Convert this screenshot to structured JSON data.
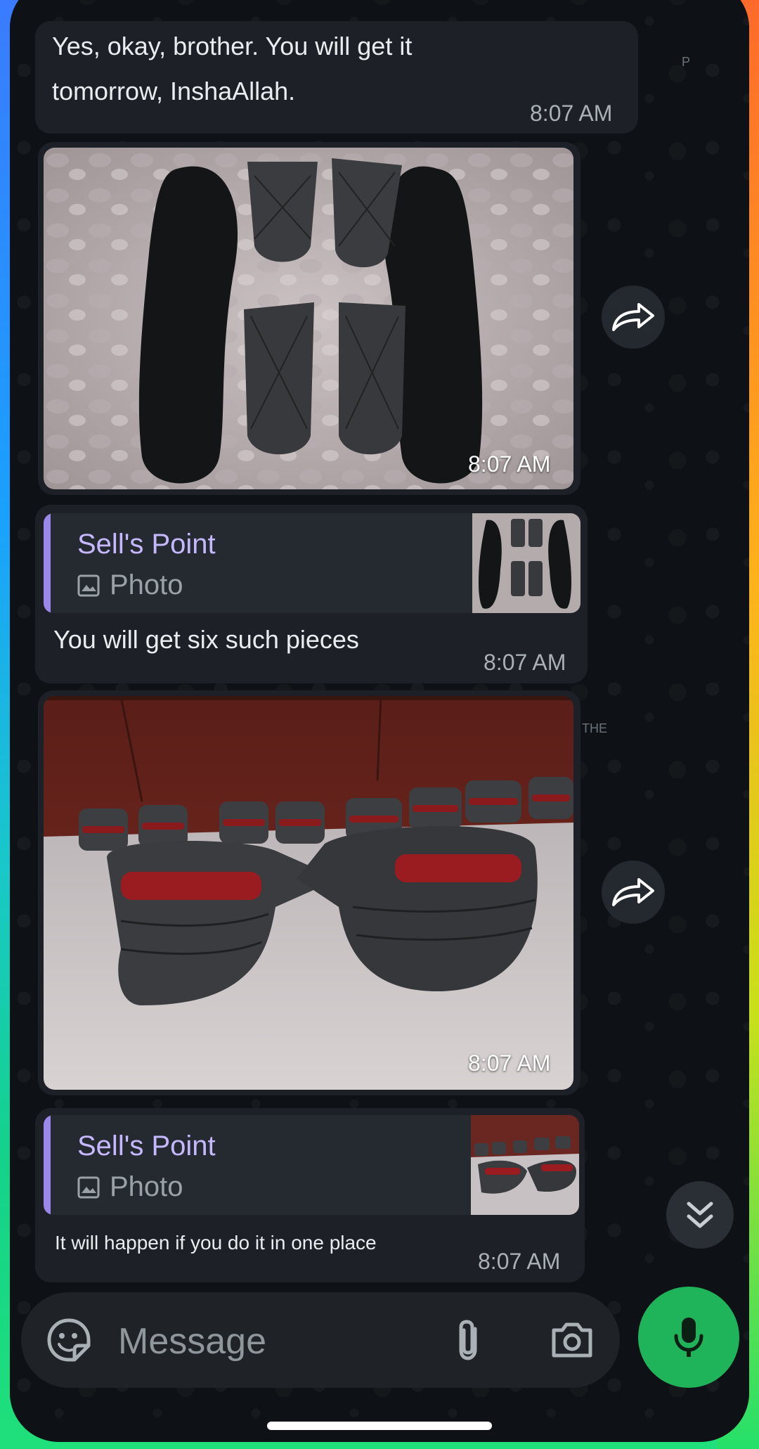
{
  "messages": {
    "text1": {
      "text": "Yes, okay, brother. You will get it tomorrow, InshaAllah.",
      "time": "8:07 AM"
    },
    "photo1": {
      "time": "8:07 AM"
    },
    "reply1": {
      "quote_name": "Sell's Point",
      "quote_type": "Photo",
      "text": "You will get six such pieces",
      "time": "8:07 AM"
    },
    "photo2": {
      "time": "8:07 AM"
    },
    "reply2": {
      "quote_name": "Sell's Point",
      "quote_type": "Photo",
      "text": "It will happen if you do it in one place",
      "time": "8:07 AM"
    }
  },
  "composer": {
    "placeholder": "Message"
  },
  "wallpaper_marks": {
    "p": "P",
    "the": "THE"
  },
  "icons": {
    "sticker": "sticker-icon",
    "attach": "paperclip-icon",
    "camera": "camera-icon",
    "mic": "mic-icon",
    "forward": "forward-icon",
    "scroll_down": "double-chevron-down-icon",
    "image": "image-icon"
  },
  "colors": {
    "accent_green": "#1fb45a",
    "quote_bar": "#9b87e8",
    "quote_name": "#c5b8ff"
  }
}
